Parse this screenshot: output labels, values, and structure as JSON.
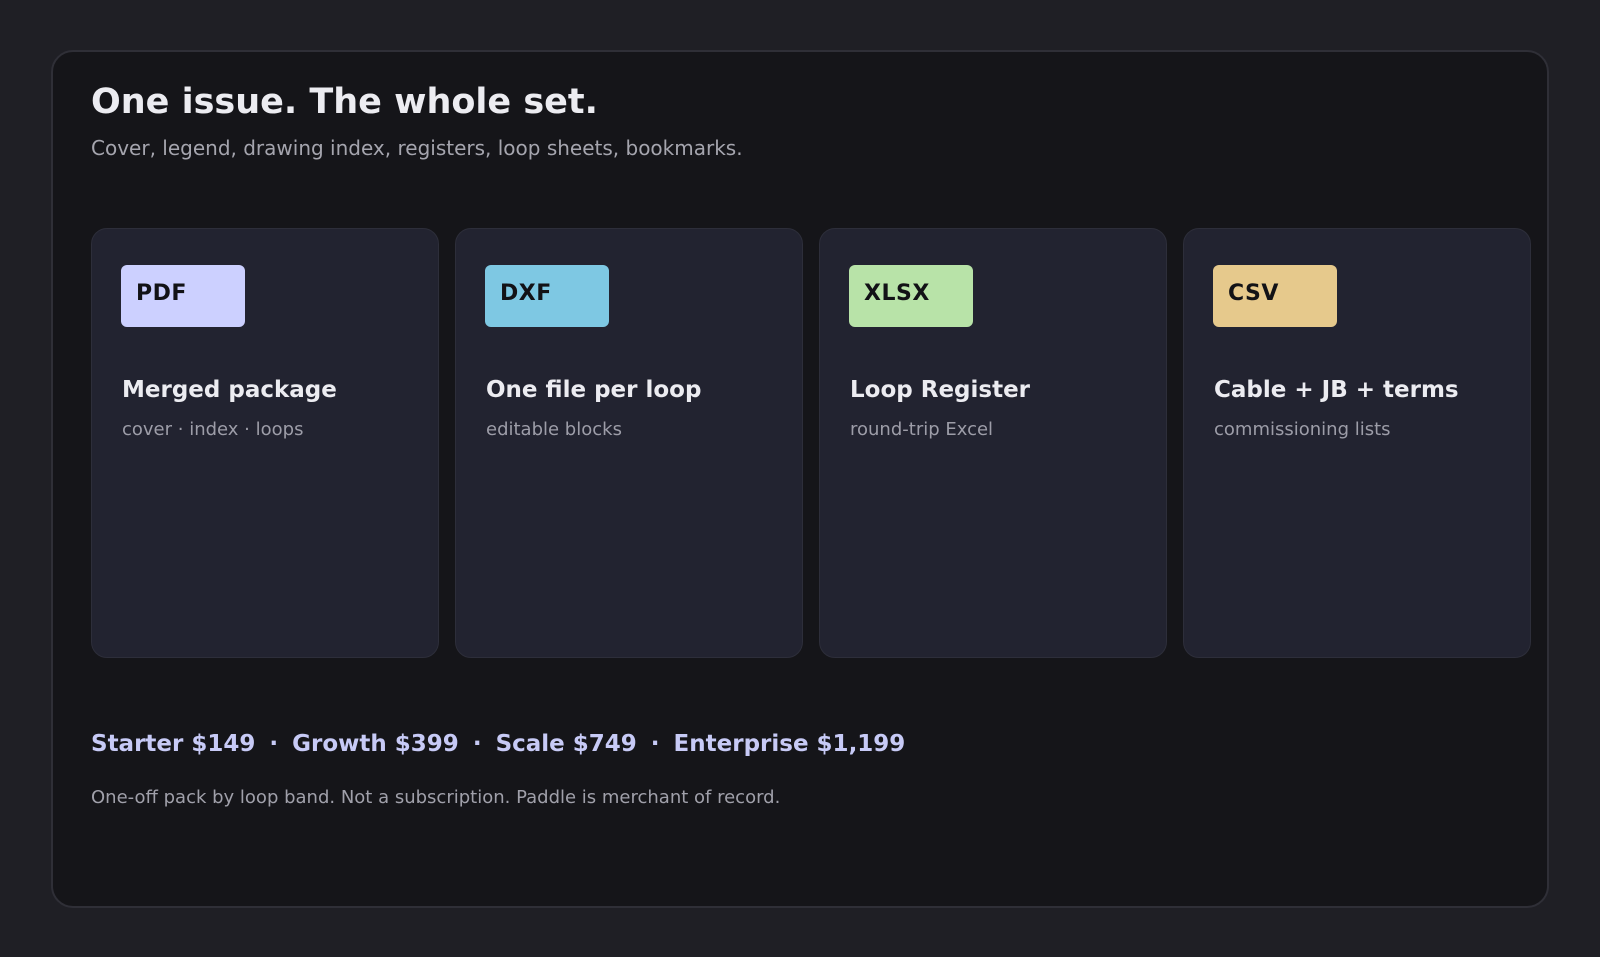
{
  "header": {
    "title": "One issue. The whole set.",
    "subtitle": "Cover, legend, drawing index, registers, loop sheets, bookmarks."
  },
  "cards": [
    {
      "badge": "PDF",
      "badge_color": "#ccd0ff",
      "title": "Merged package",
      "subtitle": "cover · index · loops"
    },
    {
      "badge": "DXF",
      "badge_color": "#7ec8e3",
      "title": "One file per loop",
      "subtitle": "editable blocks"
    },
    {
      "badge": "XLSX",
      "badge_color": "#b8e3a8",
      "title": "Loop Register",
      "subtitle": "round-trip Excel"
    },
    {
      "badge": "CSV",
      "badge_color": "#e6c98c",
      "title": "Cable + JB + terms",
      "subtitle": "commissioning lists"
    }
  ],
  "pricing": {
    "tiers": [
      "Starter $149",
      "Growth $399",
      "Scale $749",
      "Enterprise $1,199"
    ],
    "separator": "·",
    "note": "One-off pack by loop band. Not a subscription. Paddle is merchant of record."
  },
  "colors": {
    "page_background": "#1f1f25",
    "panel_background": "#151519",
    "card_background": "#222330",
    "accent": "#c7caf6"
  }
}
